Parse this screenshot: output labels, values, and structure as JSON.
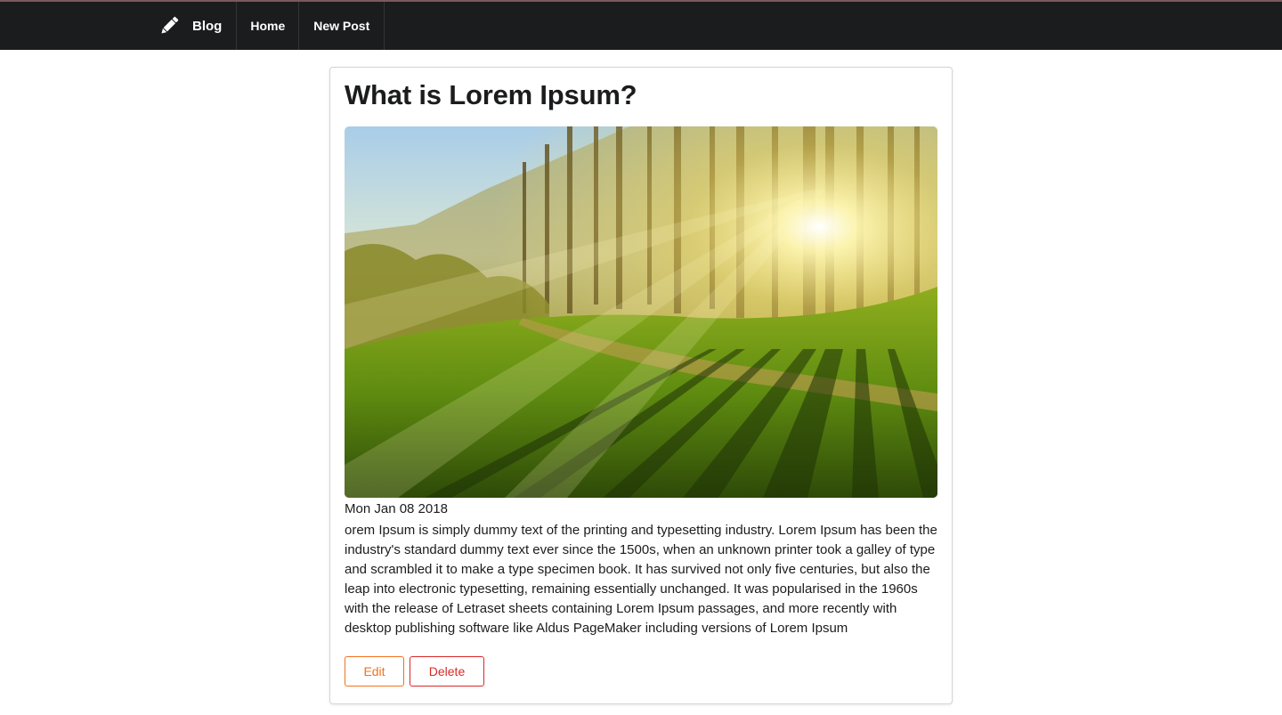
{
  "nav": {
    "brand_label": "Blog",
    "brand_icon": "pencil-icon",
    "items": [
      {
        "label": "Home"
      },
      {
        "label": "New Post"
      }
    ]
  },
  "post": {
    "title": "What is Lorem Ipsum?",
    "image": "forest-sunrise-photo",
    "date": "Mon Jan 08 2018",
    "body": "orem Ipsum is simply dummy text of the printing and typesetting industry. Lorem Ipsum has been the industry's standard dummy text ever since the 1500s, when an unknown printer took a galley of type and scrambled it to make a type specimen book. It has survived not only five centuries, but also the leap into electronic typesetting, remaining essentially unchanged. It was popularised in the 1960s with the release of Letraset sheets containing Lorem Ipsum passages, and more recently with desktop publishing software like Aldus PageMaker including versions of Lorem Ipsum",
    "actions": {
      "edit_label": "Edit",
      "delete_label": "Delete"
    }
  },
  "colors": {
    "navbar_bg": "#1b1c1d",
    "edit": "#f2711c",
    "delete": "#db2828"
  }
}
